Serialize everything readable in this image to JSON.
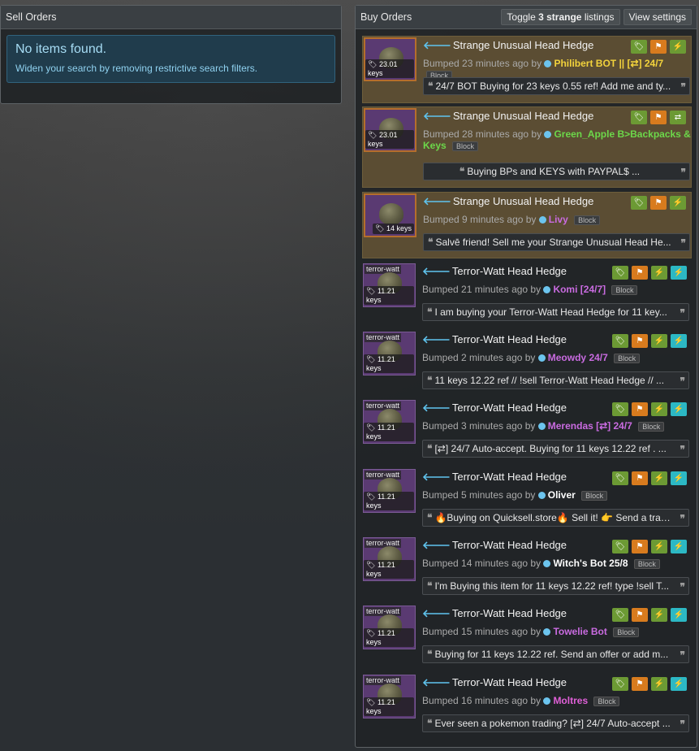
{
  "sell": {
    "title": "Sell Orders",
    "empty_title": "No items found.",
    "empty_text": "Widen your search by removing restrictive search filters."
  },
  "buy": {
    "title": "Buy Orders",
    "toggle_prefix": "Toggle",
    "toggle_count": "3 strange",
    "toggle_suffix": "listings",
    "view_settings": "View settings"
  },
  "listings": [
    {
      "item": "Strange Unusual Head Hedge",
      "price": "23.01 keys",
      "tag": "",
      "bumped": "Bumped 23 minutes ago by",
      "user": "Philibert BOT || [⇄] 24/7",
      "user_color": "#f2d23c",
      "block": "Block",
      "message": "24/7 BOT Buying for 23 keys 0.55 ref! Add me and ty...",
      "icons": [
        "g",
        "o",
        "g"
      ],
      "strange": true
    },
    {
      "item": "Strange Unusual Head Hedge",
      "price": "23.01 keys",
      "tag": "",
      "bumped": "Bumped 28 minutes ago by",
      "user": "Green_Apple B>Backpacks &",
      "user2": "Keys",
      "user_color": "#6cd84a",
      "block": "Block",
      "message": "Buying BPs and KEYS with PAYPAL$   ...",
      "icons": [
        "g",
        "o",
        "g"
      ],
      "strange": true
    },
    {
      "item": "Strange Unusual Head Hedge",
      "price": "14 keys",
      "tag": "",
      "bumped": "Bumped 9 minutes ago by",
      "user": "Livy",
      "user_color": "#c96be0",
      "block": "Block",
      "message": "Salvē friend! Sell me your Strange Unusual Head He...",
      "icons": [
        "g",
        "o",
        "g"
      ],
      "strange": true
    },
    {
      "item": "Terror-Watt Head Hedge",
      "price": "11.21 keys",
      "tag": "terror-watt",
      "bumped": "Bumped 21 minutes ago by",
      "user": "Komi [24/7]",
      "user_color": "#c96be0",
      "block": "Block",
      "message": "I am buying your Terror-Watt Head Hedge for 11 key...",
      "icons": [
        "g",
        "o",
        "g",
        "c"
      ],
      "strange": false
    },
    {
      "item": "Terror-Watt Head Hedge",
      "price": "11.21 keys",
      "tag": "terror-watt",
      "bumped": "Bumped 2 minutes ago by",
      "user": "Meowdy 24/7",
      "user_color": "#c96be0",
      "block": "Block",
      "message": "11 keys 12.22 ref // !sell Terror-Watt Head Hedge // ...",
      "icons": [
        "g",
        "o",
        "g",
        "c"
      ],
      "strange": false
    },
    {
      "item": "Terror-Watt Head Hedge",
      "price": "11.21 keys",
      "tag": "terror-watt",
      "bumped": "Bumped 3 minutes ago by",
      "user": "Merendas [⇄] 24/7",
      "user_color": "#c96be0",
      "block": "Block",
      "message": "[⇄] 24/7 Auto-accept. Buying for 11 keys 12.22 ref . ...",
      "icons": [
        "g",
        "o",
        "g",
        "c"
      ],
      "strange": false
    },
    {
      "item": "Terror-Watt Head Hedge",
      "price": "11.21 keys",
      "tag": "terror-watt",
      "bumped": "Bumped 5 minutes ago by",
      "user": "Oliver",
      "user_color": "#ffffff",
      "block": "Block",
      "message": "🔥Buying on Quicksell.store🔥 Sell it! 👉 Send a trad...",
      "icons": [
        "g",
        "o",
        "g",
        "c"
      ],
      "strange": false
    },
    {
      "item": "Terror-Watt Head Hedge",
      "price": "11.21 keys",
      "tag": "terror-watt",
      "bumped": "Bumped 14 minutes ago by",
      "user": "Witch's Bot 25/8",
      "user_color": "#ffffff",
      "block": "Block",
      "message": "I'm Buying this item for 11 keys 12.22 ref! type !sell T...",
      "icons": [
        "g",
        "o",
        "g",
        "c"
      ],
      "strange": false
    },
    {
      "item": "Terror-Watt Head Hedge",
      "price": "11.21 keys",
      "tag": "terror-watt",
      "bumped": "Bumped 15 minutes ago by",
      "user": "Towelie Bot",
      "user_color": "#c96be0",
      "block": "Block",
      "message": "Buying for 11 keys 12.22 ref. Send an offer or add m...",
      "icons": [
        "g",
        "o",
        "g",
        "c"
      ],
      "strange": false
    },
    {
      "item": "Terror-Watt Head Hedge",
      "price": "11.21 keys",
      "tag": "terror-watt",
      "bumped": "Bumped 16 minutes ago by",
      "user": "Moltres",
      "user_color": "#e060d8",
      "block": "Block",
      "message": "Ever seen a pokemon trading? [⇄] 24/7 Auto-accept ...",
      "icons": [
        "g",
        "o",
        "g",
        "c"
      ],
      "strange": false
    }
  ]
}
